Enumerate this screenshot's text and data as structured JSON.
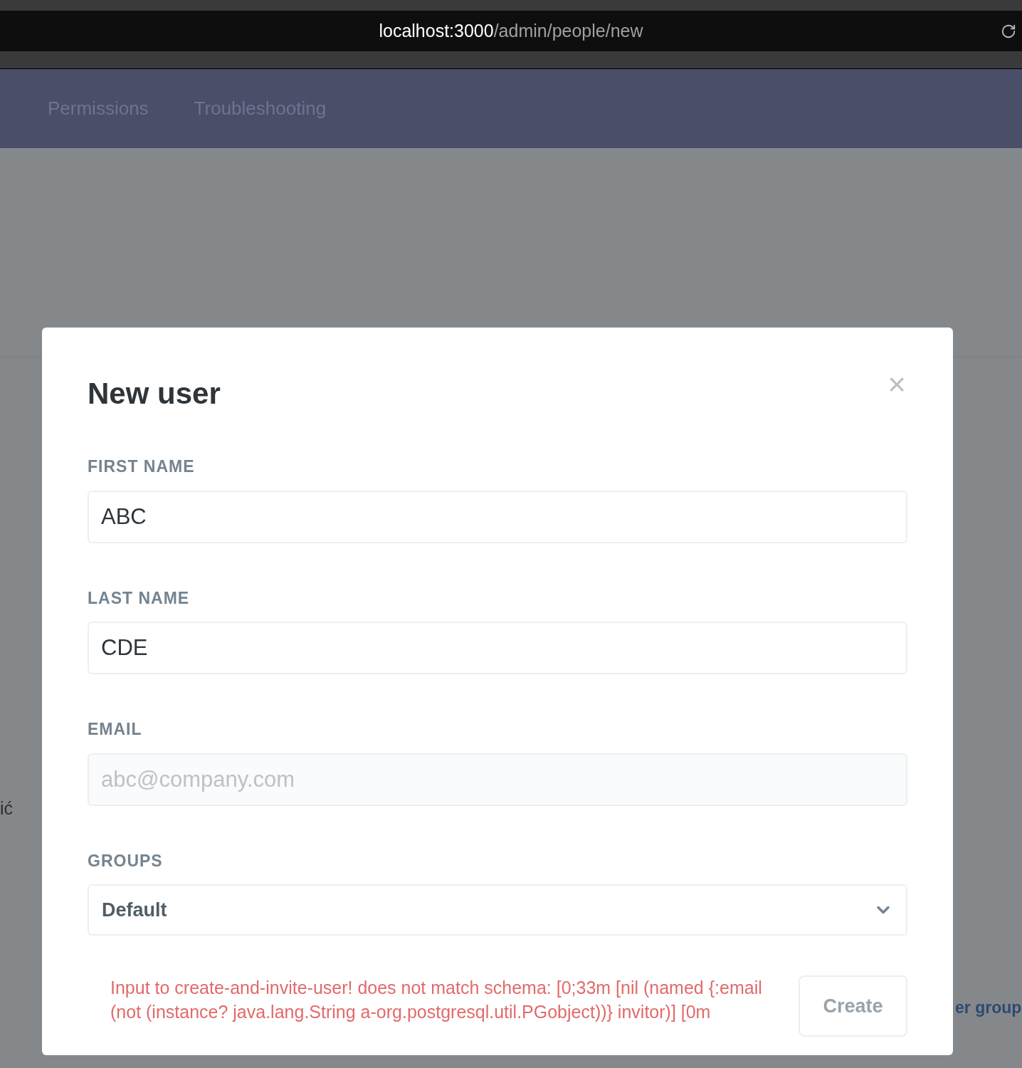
{
  "browser": {
    "url_host": "localhost:3000",
    "url_path": "/admin/people/new"
  },
  "nav": {
    "tabs": [
      {
        "label": "Permissions"
      },
      {
        "label": "Troubleshooting"
      }
    ]
  },
  "table": {
    "fragments": [
      "ić",
      "er group"
    ]
  },
  "modal": {
    "title": "New user",
    "close": "×",
    "fields": [
      {
        "kind": "text",
        "label": "FIRST NAME",
        "value": "ABC"
      },
      {
        "kind": "text",
        "label": "LAST NAME",
        "value": "CDE"
      },
      {
        "kind": "text",
        "label": "EMAIL",
        "placeholder": "abc@company.com"
      },
      {
        "kind": "select",
        "label": "GROUPS",
        "value": "Default"
      }
    ],
    "error": "Input to create-and-invite-user! does not match schema: [0;33m [nil (named {:email (not (instance? java.lang.String a-org.postgresql.util.PGobject))} invitor)] [0m",
    "button": "Create"
  }
}
